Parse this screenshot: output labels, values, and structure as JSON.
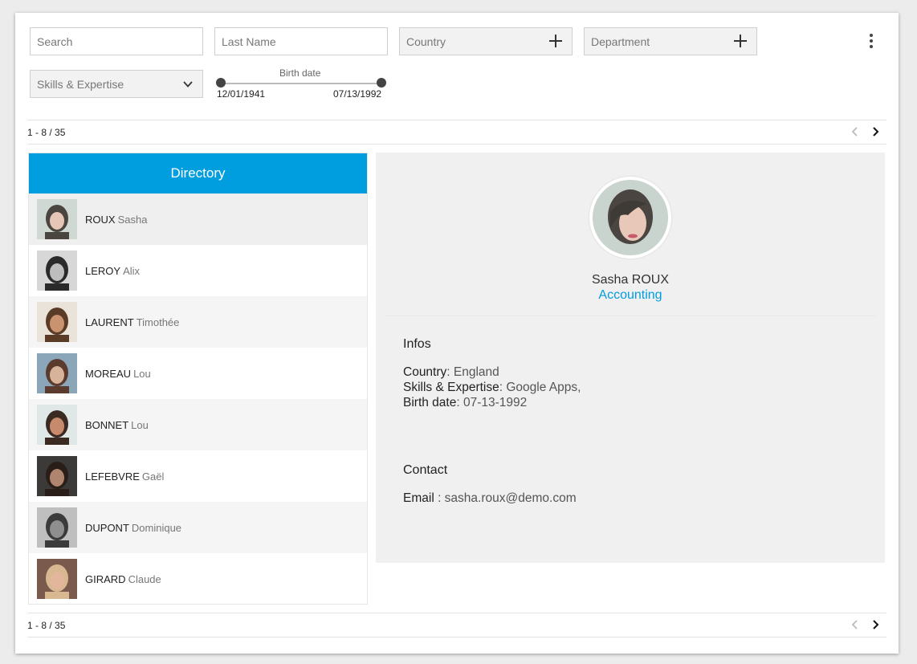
{
  "filters": {
    "search_placeholder": "Search",
    "lastname_placeholder": "Last Name",
    "country_label": "Country",
    "department_label": "Department",
    "skills_label": "Skills & Expertise"
  },
  "slider": {
    "label": "Birth date",
    "min": "12/01/1941",
    "max": "07/13/1992"
  },
  "pager": {
    "text": "1 - 8 / 35"
  },
  "directory": {
    "title": "Directory",
    "people": [
      {
        "last": "ROUX",
        "first": "Sasha"
      },
      {
        "last": "LEROY",
        "first": "Alix"
      },
      {
        "last": "LAURENT",
        "first": "Timothée"
      },
      {
        "last": "MOREAU",
        "first": "Lou"
      },
      {
        "last": "BONNET",
        "first": "Lou"
      },
      {
        "last": "LEFEBVRE",
        "first": "Gaël"
      },
      {
        "last": "DUPONT",
        "first": "Dominique"
      },
      {
        "last": "GIRARD",
        "first": "Claude"
      }
    ]
  },
  "detail": {
    "name": "Sasha ROUX",
    "department": "Accounting",
    "infos_heading": "Infos",
    "country_key": "Country",
    "country_value": ": England",
    "skills_key": "Skills & Expertise",
    "skills_value": ": Google Apps,",
    "birth_key": "Birth date",
    "birth_value": ": 07-13-1992",
    "contact_heading": "Contact",
    "email_key": "Email",
    "email_value": " : sasha.roux@demo.com"
  },
  "colors": {
    "accent": "#009ddf",
    "panel": "#f0f0f0"
  }
}
